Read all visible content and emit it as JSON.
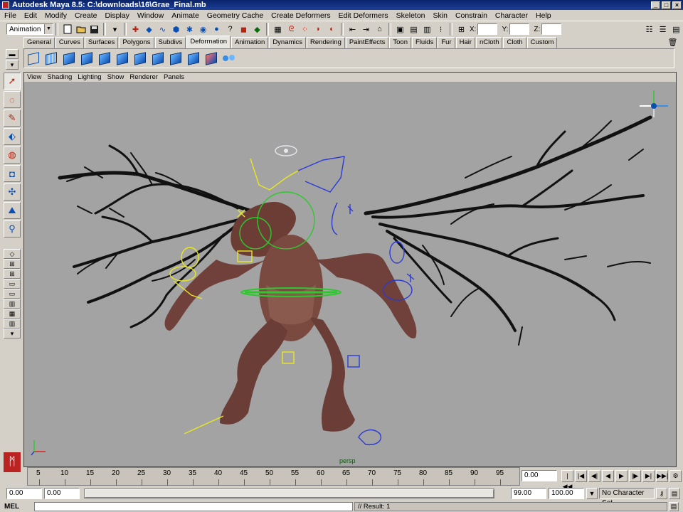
{
  "window": {
    "title": "Autodesk Maya 8.5: C:\\downloads\\16\\Grae_Final.mb"
  },
  "menubar": {
    "items": [
      "File",
      "Edit",
      "Modify",
      "Create",
      "Display",
      "Window",
      "Animate",
      "Geometry Cache",
      "Create Deformers",
      "Edit Deformers",
      "Skeleton",
      "Skin",
      "Constrain",
      "Character",
      "Help"
    ]
  },
  "statusline": {
    "mode": "Animation",
    "x_label": "X:",
    "y_label": "Y:",
    "z_label": "Z:",
    "x_value": "",
    "y_value": "",
    "z_value": ""
  },
  "shelf": {
    "tabs": [
      "General",
      "Curves",
      "Surfaces",
      "Polygons",
      "Subdivs",
      "Deformation",
      "Animation",
      "Dynamics",
      "Rendering",
      "PaintEffects",
      "Toon",
      "Fluids",
      "Fur",
      "Hair",
      "nCloth",
      "Cloth",
      "Custom"
    ],
    "active_tab": "Deformation"
  },
  "panel": {
    "menu": [
      "View",
      "Shading",
      "Lighting",
      "Show",
      "Renderer",
      "Panels"
    ],
    "camera": "persp"
  },
  "timeslider": {
    "ticks": [
      "5",
      "10",
      "15",
      "20",
      "25",
      "30",
      "35",
      "40",
      "45",
      "50",
      "55",
      "60",
      "65",
      "70",
      "75",
      "80",
      "85",
      "90",
      "95"
    ],
    "current_frame": "0.00"
  },
  "range": {
    "start": "0.00",
    "playback_start": "0.00",
    "playback_end": "99.00",
    "end": "100.00",
    "character_set": "No Character Set"
  },
  "command": {
    "label": "MEL",
    "input": "",
    "result": "// Result: 1"
  },
  "colors": {
    "viewport_bg": "#a3a3a3",
    "ui_bg": "#d4d0c8",
    "title_bar": "#0a246a",
    "rig_yellow": "#e8e81e",
    "rig_blue": "#2a3ad6",
    "rig_green": "#2ec82e"
  }
}
